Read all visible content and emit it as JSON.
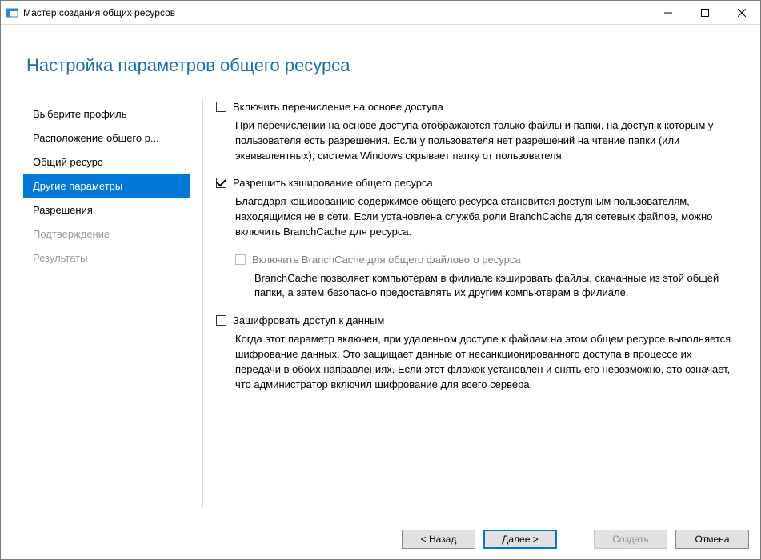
{
  "window": {
    "title": "Мастер создания общих ресурсов"
  },
  "page": {
    "heading": "Настройка параметров общего ресурса"
  },
  "sidebar": {
    "items": [
      {
        "label": "Выберите профиль",
        "state": "normal"
      },
      {
        "label": "Расположение общего р...",
        "state": "normal"
      },
      {
        "label": "Общий ресурс",
        "state": "normal"
      },
      {
        "label": "Другие параметры",
        "state": "active"
      },
      {
        "label": "Разрешения",
        "state": "normal"
      },
      {
        "label": "Подтверждение",
        "state": "disabled"
      },
      {
        "label": "Результаты",
        "state": "disabled"
      }
    ]
  },
  "options": {
    "abe": {
      "label": "Включить перечисление на основе доступа",
      "checked": false,
      "desc": "При перечислении на основе доступа отображаются только файлы и папки, на доступ к которым у пользователя есть разрешения. Если у пользователя нет разрешений на чтение папки (или эквивалентных), система Windows скрывает папку от пользователя."
    },
    "cache": {
      "label": "Разрешить кэширование общего ресурса",
      "checked": true,
      "desc": "Благодаря кэшированию содержимое общего ресурса становится доступным пользователям, находящимся не в сети. Если установлена служба роли BranchCache для сетевых файлов, можно включить BranchCache для ресурса."
    },
    "branchcache": {
      "label": "Включить BranchCache для общего файлового ресурса",
      "checked": false,
      "enabled": false,
      "desc": "BranchCache позволяет компьютерам в филиале кэшировать файлы, скачанные из этой общей папки, а затем безопасно предоставлять их другим компьютерам в филиале."
    },
    "encrypt": {
      "label": "Зашифровать доступ к данным",
      "checked": false,
      "desc": "Когда этот параметр включен, при удаленном доступе к файлам на этом общем ресурсе выполняется шифрование данных. Это защищает данные от несанкционированного доступа в процессе их передачи в обоих направлениях. Если этот флажок установлен и снять его невозможно, это означает, что администратор включил шифрование для всего сервера."
    }
  },
  "footer": {
    "back": "< Назад",
    "next": "Далее >",
    "create": "Создать",
    "cancel": "Отмена"
  }
}
